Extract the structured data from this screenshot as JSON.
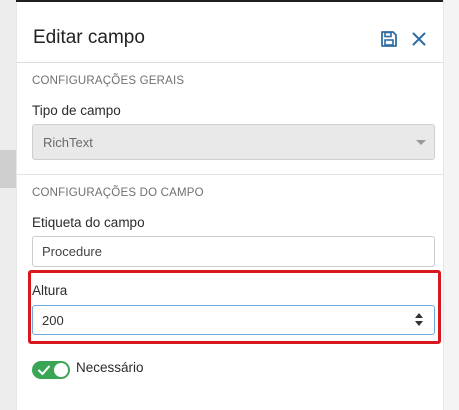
{
  "window": {
    "title": "Editar campo"
  },
  "header": {
    "save_icon": "save-icon",
    "close_icon": "close-icon"
  },
  "general_section": {
    "title": "CONFIGURAÇÕES GERAIS",
    "field_type_label": "Tipo de campo",
    "field_type_value": "RichText"
  },
  "field_section": {
    "title": "CONFIGURAÇÕES DO CAMPO",
    "label_label": "Etiqueta do campo",
    "label_value": "Procedure",
    "height_label": "Altura",
    "height_value": "200",
    "required_label": "Necessário",
    "required_on": true
  },
  "colors": {
    "accent": "#3aa655",
    "highlight": "#d7191f",
    "focus": "#6ea8dc"
  }
}
